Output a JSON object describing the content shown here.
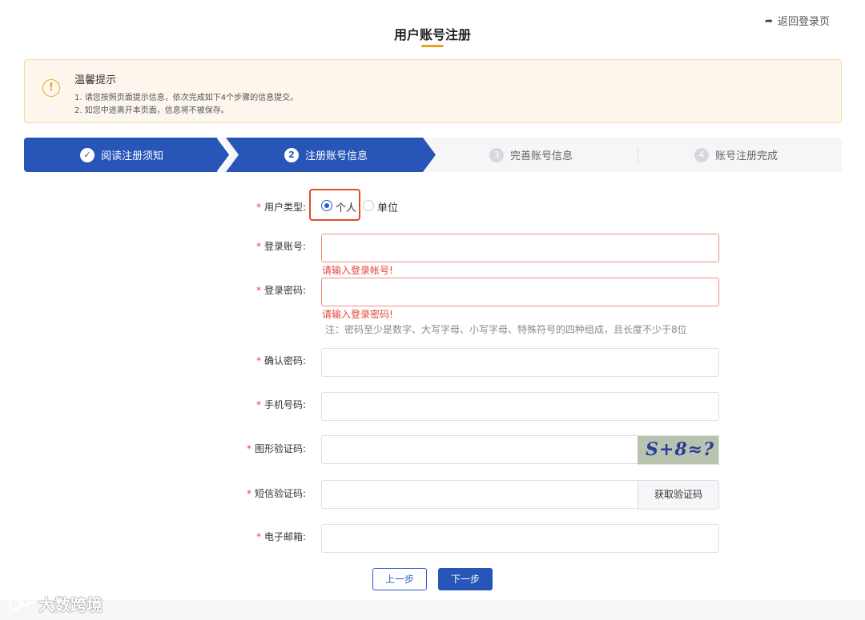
{
  "header": {
    "title": "用户账号注册",
    "back_link": "返回登录页"
  },
  "tip": {
    "title": "温馨提示",
    "icon": "!",
    "line1": "1. 请您按照页面提示信息，依次完成如下4个步骤的信息提交。",
    "line2": "2. 如您中途离开本页面，信息将不被保存。"
  },
  "steps": [
    {
      "num": "✓",
      "label": "阅读注册须知",
      "state": "done"
    },
    {
      "num": "2",
      "label": "注册账号信息",
      "state": "active"
    },
    {
      "num": "3",
      "label": "完善账号信息",
      "state": "pending"
    },
    {
      "num": "4",
      "label": "账号注册完成",
      "state": "pending"
    }
  ],
  "form": {
    "user_type": {
      "label": "用户类型:",
      "options": [
        "个人",
        "单位"
      ],
      "selected": "个人"
    },
    "account": {
      "label": "登录账号:",
      "value": "",
      "error": "请输入登录帐号!"
    },
    "password": {
      "label": "登录密码:",
      "value": "",
      "error": "请输入登录密码!",
      "hint": "注：密码至少是数字、大写字母、小写字母、特殊符号的四种组成，且长度不少于8位"
    },
    "confirm_password": {
      "label": "确认密码:",
      "value": ""
    },
    "phone": {
      "label": "手机号码:",
      "value": ""
    },
    "captcha": {
      "label": "图形验证码:",
      "value": "",
      "image_text": "S+8≈?"
    },
    "sms_code": {
      "label": "短信验证码:",
      "value": "",
      "button": "获取验证码"
    },
    "email": {
      "label": "电子邮箱:",
      "value": ""
    },
    "required_mark": "*"
  },
  "actions": {
    "prev": "上一步",
    "next": "下一步"
  },
  "watermark": "大数跨境",
  "colors": {
    "primary": "#2755b8",
    "error": "#e0463b",
    "warning": "#f0a020",
    "tip_bg": "#fdf6ec"
  }
}
